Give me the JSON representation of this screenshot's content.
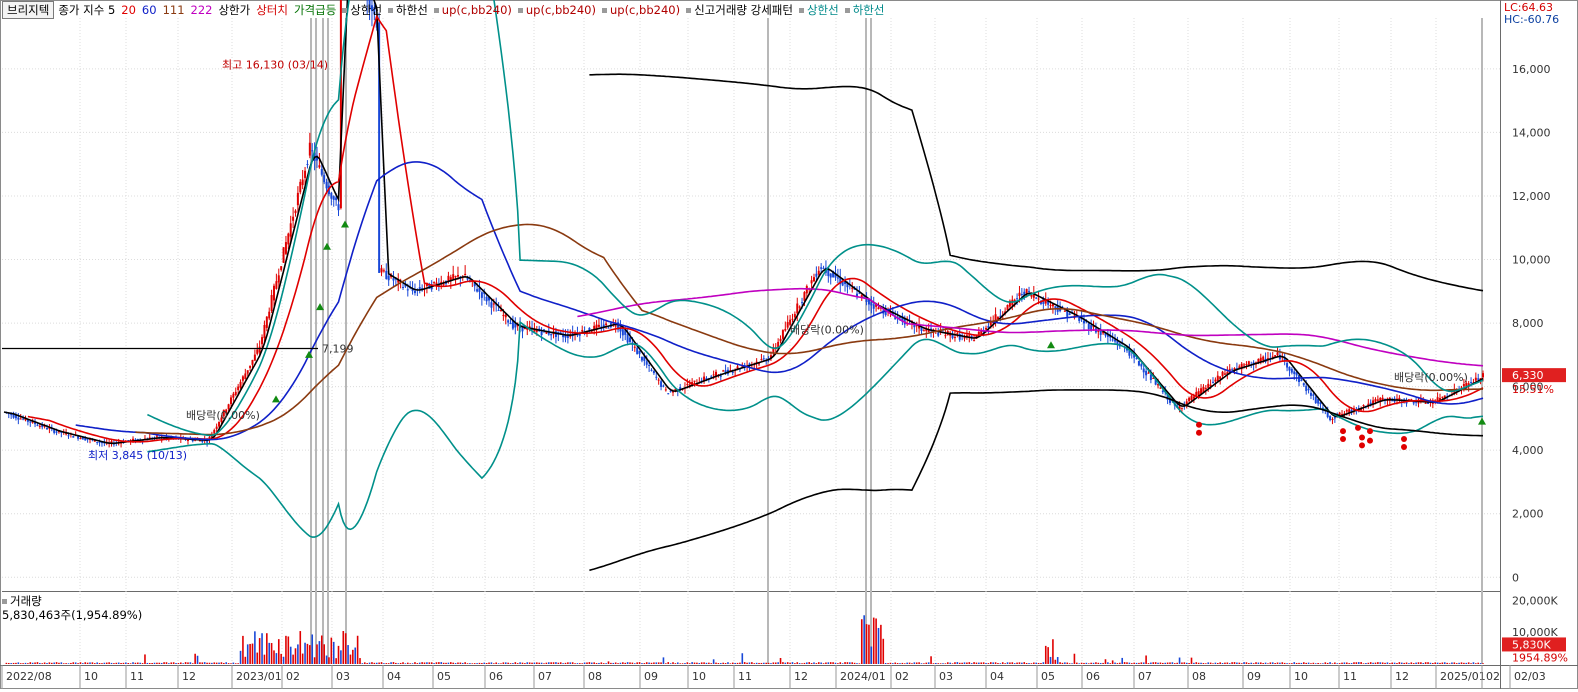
{
  "legend": {
    "name": "브리지텍",
    "close_label": "종가 지수 5",
    "ma_periods": [
      "20",
      "60",
      "111",
      "222"
    ],
    "ma_colors": [
      "#e00000",
      "#1020c8",
      "#8a3a10",
      "#c000c0"
    ],
    "items": [
      {
        "label": "상한가",
        "color": "#000000"
      },
      {
        "label": "상터치",
        "color": "#d40000"
      },
      {
        "label": "가격급등",
        "color": "#007000"
      },
      {
        "label": "상한선",
        "color": "#000000"
      },
      {
        "label": "하한선",
        "color": "#000000"
      },
      {
        "label": "up(c,bb240)",
        "color": "#b00000"
      },
      {
        "label": "up(c,bb240)",
        "color": "#b00000"
      },
      {
        "label": "up(c,bb240)",
        "color": "#b00000"
      },
      {
        "label": "신고거래량 강세패턴",
        "color": "#000000"
      },
      {
        "label": "상한선",
        "color": "#008a8a"
      },
      {
        "label": "하한선",
        "color": "#008a8a"
      }
    ]
  },
  "corner": {
    "lc": "LC:64.63",
    "hc": "HC:-60.76"
  },
  "volume_legend": {
    "title": "거래량",
    "value": "5,830,463주(1,954.89%)"
  },
  "colors": {
    "up": "#e00000",
    "down": "#1848d8",
    "bb_outer": "#000000",
    "bb_inner": "#00908a",
    "bb_inner2": "#20b0b0",
    "price_tag": "#e02020"
  },
  "chart_data": {
    "type": "candlestick",
    "title": "",
    "xlabel": "",
    "ylabel": "",
    "y_ticks": [
      "0",
      "2,000",
      "4,000",
      "6,000",
      "8,000",
      "10,000",
      "12,000",
      "14,000",
      "16,000"
    ],
    "ylim": [
      -400,
      17600
    ],
    "x_ticks": [
      "2022/08",
      "10",
      "11",
      "12",
      "2023/01",
      "02",
      "03",
      "04",
      "05",
      "06",
      "07",
      "08",
      "09",
      "10",
      "11",
      "12",
      "2024/01",
      "02",
      "03",
      "04",
      "05",
      "06",
      "07",
      "08",
      "09",
      "10",
      "11",
      "12",
      "2025/01",
      "02",
      "02/03"
    ],
    "series_close": [
      {
        "date": "2022/08",
        "close": 5200
      },
      {
        "date": "2022/10",
        "close": 4600
      },
      {
        "date": "2022/11",
        "close": 4200
      },
      {
        "date": "2022/12",
        "close": 4400
      },
      {
        "date": "2023/01",
        "close": 4300
      },
      {
        "date": "2023/02",
        "close": 7200
      },
      {
        "date": "2023/03",
        "close": 13500
      },
      {
        "date": "2023/04",
        "close": 10000
      },
      {
        "date": "2023/05",
        "close": 9000
      },
      {
        "date": "2023/06",
        "close": 9500
      },
      {
        "date": "2023/07",
        "close": 7900
      },
      {
        "date": "2023/08",
        "close": 7600
      },
      {
        "date": "2023/09",
        "close": 8000
      },
      {
        "date": "2023/10",
        "close": 5800
      },
      {
        "date": "2023/11",
        "close": 6400
      },
      {
        "date": "2023/12",
        "close": 6900
      },
      {
        "date": "2024/01",
        "close": 9800
      },
      {
        "date": "2024/02",
        "close": 8600
      },
      {
        "date": "2024/03",
        "close": 7800
      },
      {
        "date": "2024/04",
        "close": 7500
      },
      {
        "date": "2024/05",
        "close": 9000
      },
      {
        "date": "2024/06",
        "close": 8200
      },
      {
        "date": "2024/07",
        "close": 7200
      },
      {
        "date": "2024/08",
        "close": 5300
      },
      {
        "date": "2024/09",
        "close": 6500
      },
      {
        "date": "2024/10",
        "close": 7000
      },
      {
        "date": "2024/11",
        "close": 5000
      },
      {
        "date": "2024/12",
        "close": 5600
      },
      {
        "date": "2025/01",
        "close": 5500
      },
      {
        "date": "2025/02",
        "close": 6330
      }
    ],
    "moving_averages": [
      "20",
      "60",
      "111",
      "222"
    ],
    "annotations": [
      {
        "text": "최고 16,130 (03/14)",
        "value": 16130
      },
      {
        "text": "최저 3,845 (10/13)",
        "value": 3845
      },
      {
        "text": "7,199",
        "value": 7199
      },
      {
        "text": "배당락(0.00%)",
        "value": 5100
      },
      {
        "text": "배당락(0.00%)",
        "value": 7800
      },
      {
        "text": "배당락(0.00%)",
        "value": 6300
      }
    ],
    "last_price": {
      "value": "6,330",
      "change": "15.51%"
    },
    "volume": {
      "y_ticks": [
        "20,000K",
        "10,000K"
      ],
      "last_value": "5,830K",
      "last_pct": "1954.89%"
    },
    "grid": true
  }
}
